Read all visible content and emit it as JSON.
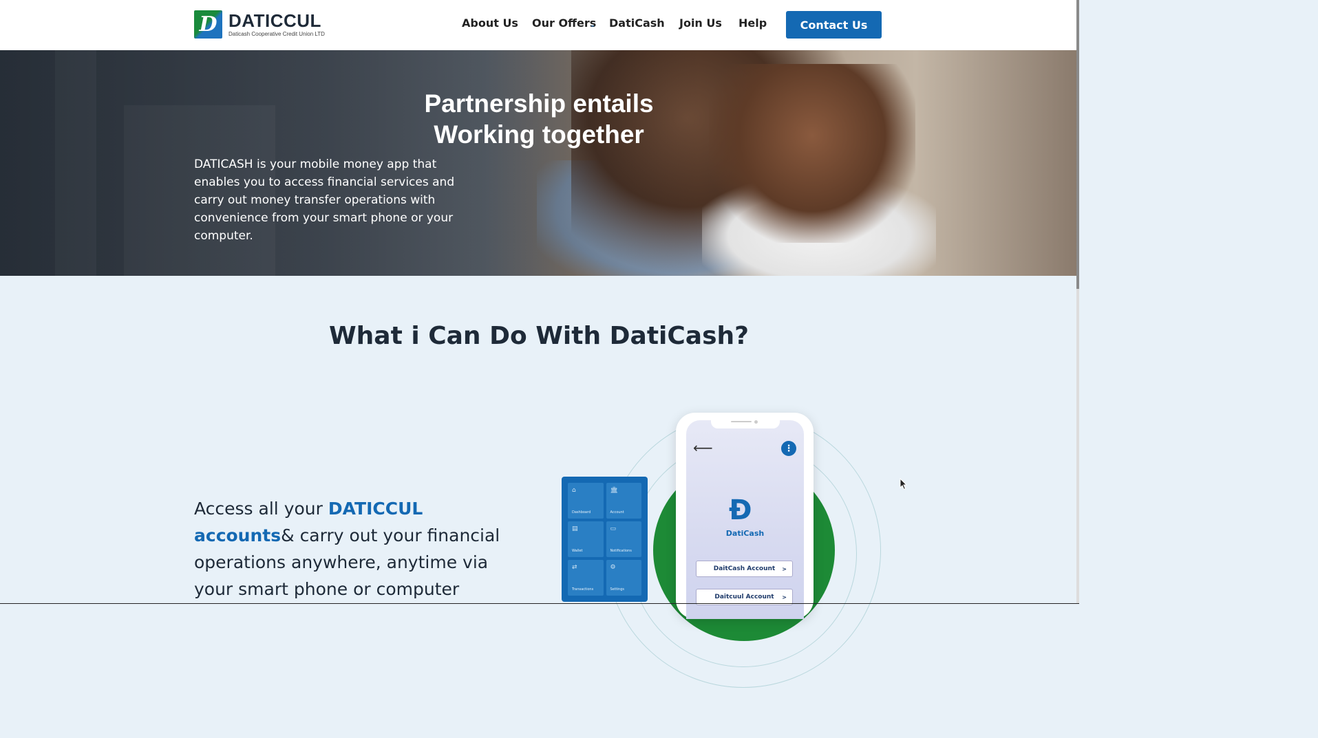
{
  "header": {
    "logo_letter": "D",
    "logo_title": "DATICCUL",
    "logo_subtitle": "Daticash Cooperative Credit Union LTD",
    "nav": [
      {
        "label": "About Us"
      },
      {
        "label": "Our Offers",
        "has_dropdown": true
      },
      {
        "label": "DatiCash"
      },
      {
        "label": "Join Us"
      },
      {
        "label": "Help"
      }
    ],
    "contact_label": "Contact Us"
  },
  "hero": {
    "title_line1": "Partnership entails",
    "title_line2": "Working together",
    "description": "DATICASH is your mobile money app that enables you to access financial services and carry out money transfer operations with convenience from your smart phone or your computer."
  },
  "section": {
    "title": "What i Can Do With DatiCash?",
    "access_prefix": "Access all your ",
    "access_highlight": "DATICCUL accounts",
    "access_suffix": "& carry out your financial operations anywhere, anytime via your smart phone or computer"
  },
  "phone": {
    "app_name": "DatiCash",
    "accounts": [
      {
        "label": "DaitCash Account",
        "arrow": ">"
      },
      {
        "label": "Daitcuul Account",
        "arrow": ">"
      }
    ]
  },
  "tablet": {
    "tiles": [
      {
        "label": "Dashboard",
        "icon": "home-icon",
        "glyph": "⌂"
      },
      {
        "label": "Account",
        "icon": "bank-icon",
        "glyph": "🏛"
      },
      {
        "label": "Wallet",
        "icon": "wallet-icon",
        "glyph": "▤"
      },
      {
        "label": "Notifications",
        "icon": "bell-icon",
        "glyph": "▭"
      },
      {
        "label": "Transactions",
        "icon": "transfer-icon",
        "glyph": "⇄"
      },
      {
        "label": "Settings",
        "icon": "settings-icon",
        "glyph": "⚙"
      }
    ]
  },
  "colors": {
    "brand_blue": "#1469b3",
    "brand_green": "#1d8a36",
    "section_bg": "#e8f1f8"
  }
}
